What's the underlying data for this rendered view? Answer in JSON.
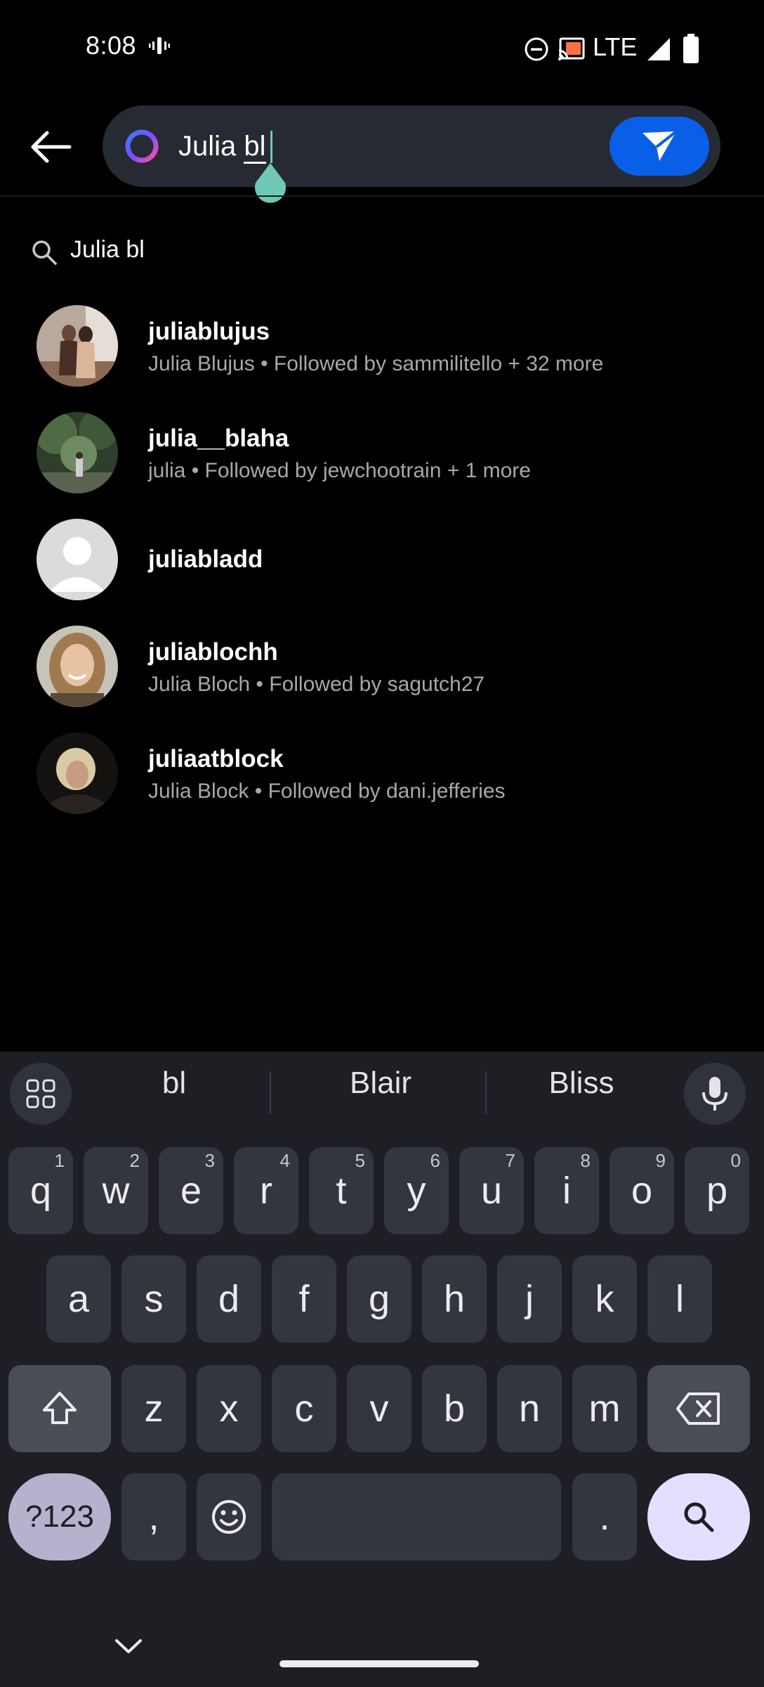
{
  "status_bar": {
    "time": "8:08",
    "network": "LTE"
  },
  "search": {
    "query_prefix": "Julia ",
    "query_underlined": "bl",
    "send_button": "send-icon"
  },
  "query_suggestion": {
    "text": "Julia bl"
  },
  "results": [
    {
      "username": "juliablujus",
      "meta": "Julia Blujus • Followed by sammilitello + 32 more"
    },
    {
      "username": "julia__blaha",
      "meta": "julia • Followed by jewchootrain + 1 more"
    },
    {
      "username": "juliabladd",
      "meta": ""
    },
    {
      "username": "juliablochh",
      "meta": "Julia Bloch • Followed by sagutch27"
    },
    {
      "username": "juliaatblock",
      "meta": "Julia Block • Followed by dani.jefferies"
    }
  ],
  "keyboard": {
    "suggestions": [
      "bl",
      "Blair",
      "Bliss"
    ],
    "row1": [
      {
        "key": "q",
        "hint": "1"
      },
      {
        "key": "w",
        "hint": "2"
      },
      {
        "key": "e",
        "hint": "3"
      },
      {
        "key": "r",
        "hint": "4"
      },
      {
        "key": "t",
        "hint": "5"
      },
      {
        "key": "y",
        "hint": "6"
      },
      {
        "key": "u",
        "hint": "7"
      },
      {
        "key": "i",
        "hint": "8"
      },
      {
        "key": "o",
        "hint": "9"
      },
      {
        "key": "p",
        "hint": "0"
      }
    ],
    "row2": [
      "a",
      "s",
      "d",
      "f",
      "g",
      "h",
      "j",
      "k",
      "l"
    ],
    "row3": [
      "z",
      "x",
      "c",
      "v",
      "b",
      "n",
      "m"
    ],
    "symbols_key": "?123",
    "comma_key": ",",
    "period_key": "."
  },
  "colors": {
    "accent_blue": "#0a5fe8",
    "caret_teal": "#6fc7b6",
    "keyboard_bg": "#1d1f25",
    "search_key": "#e4dfff"
  }
}
